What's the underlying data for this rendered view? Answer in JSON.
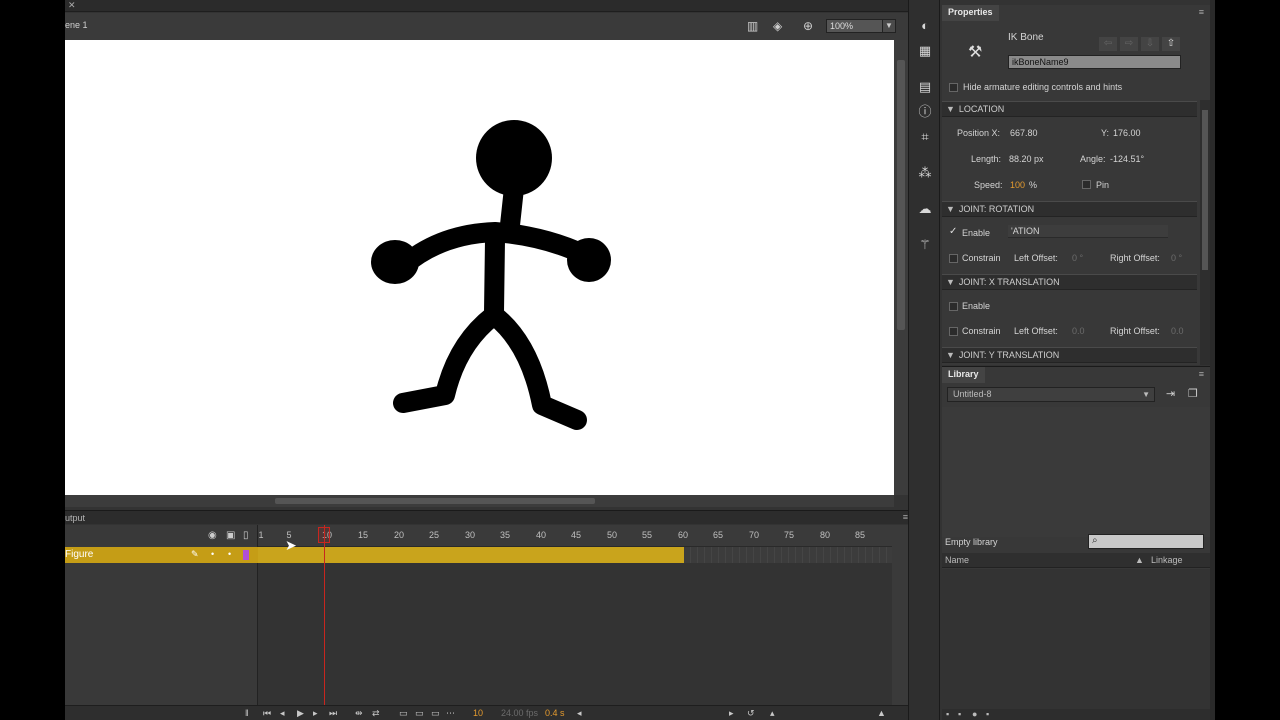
{
  "document": {
    "scene_label": "ene 1",
    "zoom": "100%"
  },
  "timeline": {
    "panel_label": "utput",
    "layer_name": "Figure",
    "ruler_ticks": [
      "1",
      "5",
      "10",
      "15",
      "20",
      "25",
      "30",
      "35",
      "40",
      "45",
      "50",
      "55",
      "60",
      "65",
      "70",
      "75",
      "80",
      "85"
    ],
    "current_frame": "10",
    "fps": "24.00 fps",
    "time": "0.4 s"
  },
  "properties": {
    "tab_label": "Properties",
    "object_type": "IK Bone",
    "bone_name": "ikBoneName9",
    "hide_controls_label": "Hide armature editing controls and hints",
    "location": {
      "section_label": "LOCATION",
      "pos_x_label": "Position X:",
      "pos_x_value": "667.80",
      "y_label": "Y:",
      "y_value": "176.00",
      "length_label": "Length:",
      "length_value": "88.20 px",
      "angle_label": "Angle:",
      "angle_value": "-124.51°",
      "speed_label": "Speed:",
      "speed_value": "100",
      "speed_unit": "%",
      "pin_label": "Pin"
    },
    "joint_rotation": {
      "section_label": "JOINT: ROTATION",
      "enable_label": "Enable",
      "enable_checked": true,
      "overlay_text": "'ATION",
      "constrain_label": "Constrain",
      "left_offset_label": "Left Offset:",
      "left_offset_value": "0 °",
      "right_offset_label": "Right Offset:",
      "right_offset_value": "0 °"
    },
    "joint_x": {
      "section_label": "JOINT: X TRANSLATION",
      "enable_label": "Enable",
      "constrain_label": "Constrain",
      "left_offset_label": "Left Offset:",
      "left_offset_value": "0.0",
      "right_offset_label": "Right Offset:",
      "right_offset_value": "0.0"
    },
    "joint_y": {
      "section_label": "JOINT: Y TRANSLATION"
    }
  },
  "library": {
    "tab_label": "Library",
    "document_select": "Untitled-8",
    "empty_label": "Empty library",
    "col_name": "Name",
    "col_linkage": "Linkage"
  }
}
